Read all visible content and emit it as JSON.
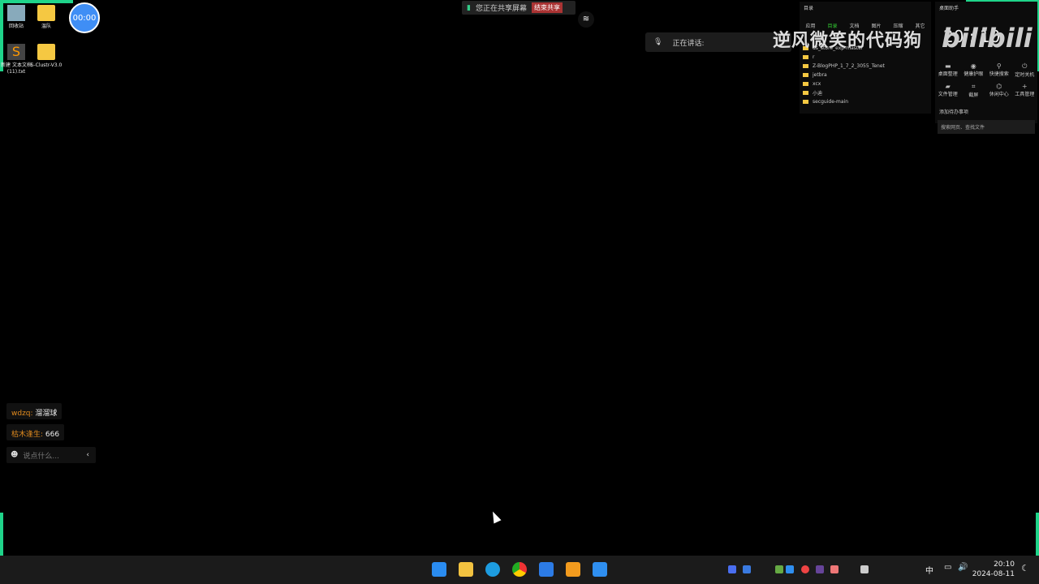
{
  "desktop": {
    "icons": [
      {
        "label": "回收站"
      },
      {
        "label": "温队"
      },
      {
        "label": "新建 文本文档 (11).txt"
      },
      {
        "label": "S-Clustr-V3.0"
      }
    ],
    "timer": "00:00"
  },
  "share_bar": {
    "status": "您正在共享屏幕",
    "end_button": "结束共享"
  },
  "speaking": {
    "label": "正在讲话:"
  },
  "watermark": {
    "text": "逆风微笑的代码狗",
    "logo": "bilibili"
  },
  "file_panel": {
    "title": "目录",
    "tabs": [
      "应用",
      "目录",
      "文档",
      "图片",
      "压缩",
      "其它"
    ],
    "active_tab": "目录",
    "items": [
      "ds_store_exp-master",
      "r",
      "Z-BlogPHP_1_7_2_3055_Tenet",
      "jetbra",
      "xcx",
      "小迪",
      "secguide-main"
    ]
  },
  "assistant": {
    "title": "桌面助手",
    "time": "20 : 10",
    "tools": [
      "桌面整理",
      "健康护眼",
      "快捷搜索",
      "定时关机",
      "文件管理",
      "截屏",
      "休闲中心",
      "工具管理"
    ],
    "todo": "添加待办事项",
    "search_placeholder": "搜索网页、查找文件"
  },
  "chat": {
    "messages": [
      {
        "user": "wdzq:",
        "text": "溜溜球"
      },
      {
        "user": "枯木逢生:",
        "text": "666"
      }
    ],
    "input_placeholder": "说点什么..."
  },
  "taskbar": {
    "ime": "中",
    "time": "20:10",
    "date": "2024-08-11"
  },
  "colors": {
    "accent": "#1fd48a",
    "share_end": "#a33333"
  }
}
